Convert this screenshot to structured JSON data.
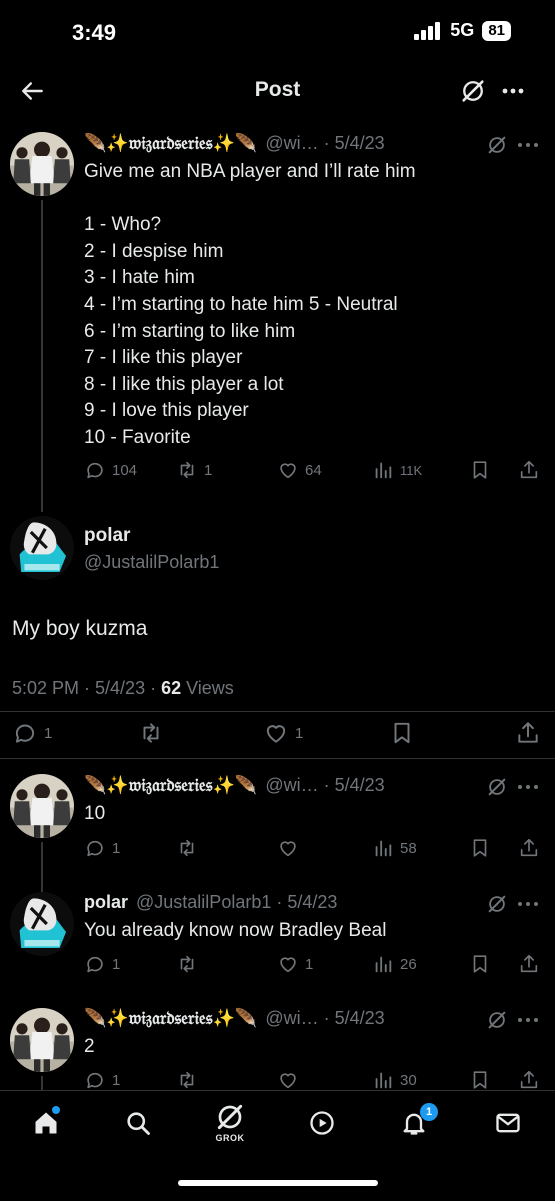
{
  "status_bar": {
    "time": "3:49",
    "network": "5G",
    "battery": "81"
  },
  "header": {
    "title": "Post"
  },
  "parent_post": {
    "display_name": "🪶✨𝔴𝔦𝔷𝔞𝔯𝔡𝔰𝔢𝔯𝔦𝔢𝔰✨🪶",
    "handle_time": "@wi… · 5/4/23",
    "lines": [
      "Give me an NBA player and I’ll rate him",
      "",
      "1 - Who?",
      "2 - I despise him",
      "3 - I hate him",
      "4 - I’m starting to hate him 5 - Neutral",
      "6 - I’m starting to like him",
      "7 - I like this player",
      "8 - I like this player a lot",
      "9 - I love this player",
      "10 - Favorite"
    ],
    "replies": "104",
    "reposts": "1",
    "likes": "64",
    "views": "11K"
  },
  "main_post": {
    "display_name": "polar",
    "handle": "@JustalilPolarb1",
    "text": "My boy kuzma",
    "timestamp": "5:02 PM · 5/4/23 · ",
    "view_count": "62",
    "views_label": " Views",
    "replies": "1",
    "likes": "1"
  },
  "replies": [
    {
      "display_name": "🪶✨𝔴𝔦𝔷𝔞𝔯𝔡𝔰𝔢𝔯𝔦𝔢𝔰✨🪶",
      "handle_time": "@wi… · 5/4/23",
      "text": "10",
      "replies": "1",
      "reposts": "",
      "likes": "",
      "views": "58"
    },
    {
      "display_name": "polar",
      "handle_time": "@JustalilPolarb1 · 5/4/23",
      "text": "You already know now Bradley Beal",
      "replies": "1",
      "reposts": "",
      "likes": "1",
      "views": "26"
    },
    {
      "display_name": "🪶✨𝔴𝔦𝔷𝔞𝔯𝔡𝔰𝔢𝔯𝔦𝔢𝔰✨🪶",
      "handle_time": "@wi… · 5/4/23",
      "text": "2",
      "replies": "1",
      "reposts": "",
      "likes": "",
      "views": "30"
    }
  ],
  "bottom_nav": {
    "grok_label": "GROK",
    "notifications_badge": "1"
  },
  "colors": {
    "background": "#000000",
    "text": "#e7e9ea",
    "secondary": "#71767b",
    "accent": "#1d9bf0"
  },
  "icons": [
    "back-arrow-icon",
    "grok-icon",
    "more-icon",
    "reply-icon",
    "repost-icon",
    "like-icon",
    "views-icon",
    "bookmark-icon",
    "share-icon",
    "home-icon",
    "search-icon",
    "play-icon",
    "bell-icon",
    "mail-icon"
  ]
}
